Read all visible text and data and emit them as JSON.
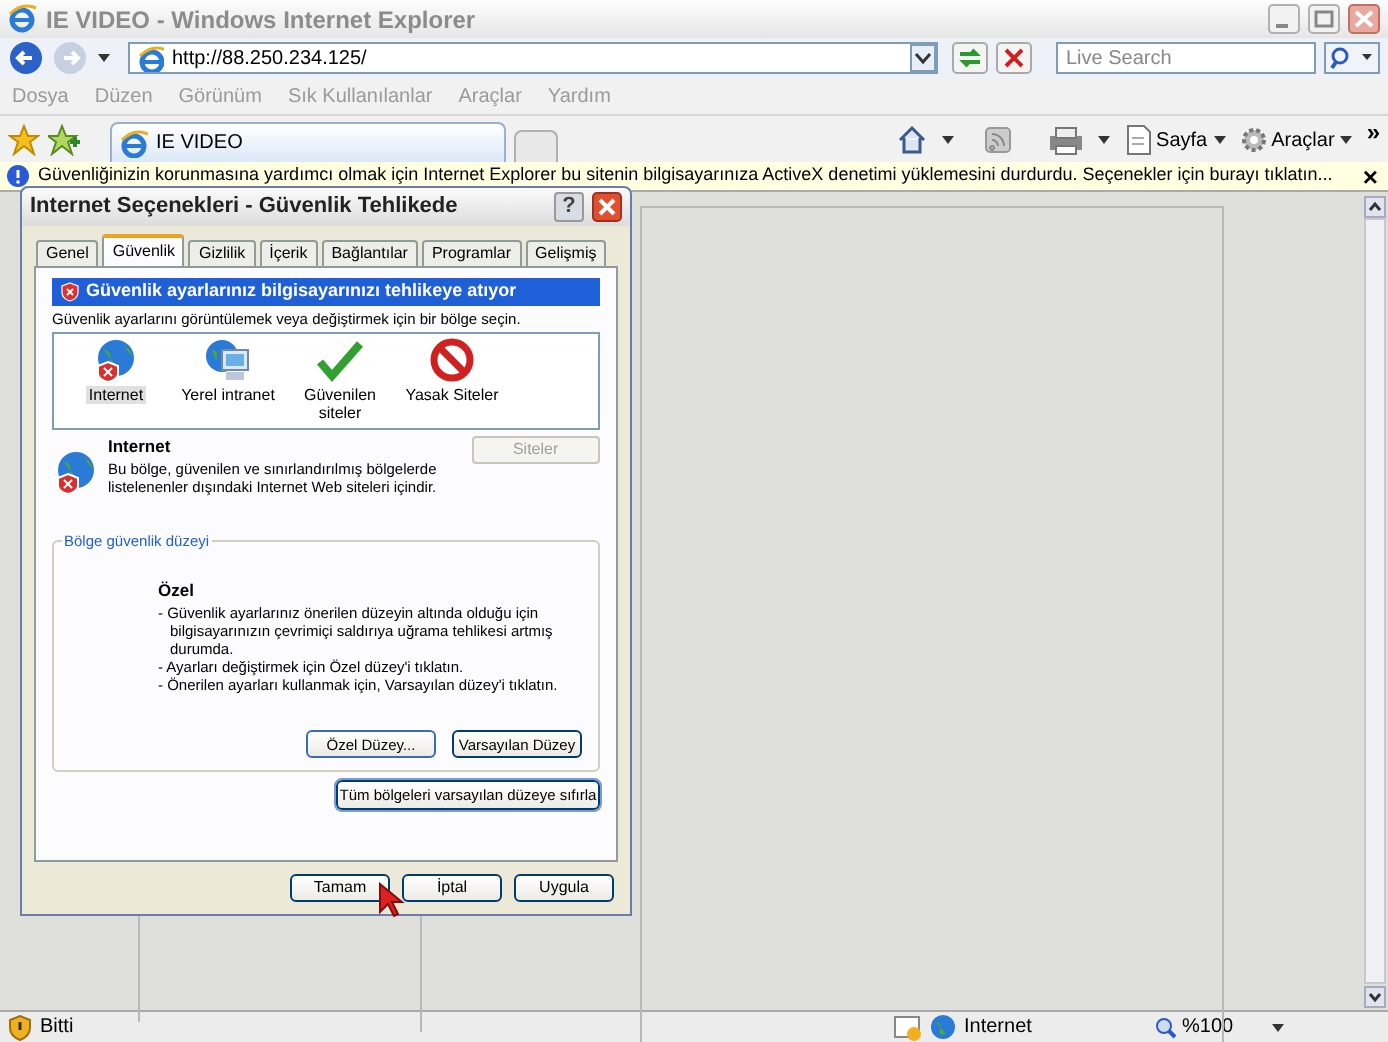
{
  "window": {
    "title": "IE VIDEO - Windows Internet Explorer"
  },
  "address": {
    "value": "http://88.250.234.125/"
  },
  "search": {
    "placeholder": "Live Search"
  },
  "menu": [
    "Dosya",
    "Düzen",
    "Görünüm",
    "Sık Kullanılanlar",
    "Araçlar",
    "Yardım"
  ],
  "tabs": [
    {
      "label": "IE VIDEO",
      "selected": true
    }
  ],
  "toolbar": {
    "page": "Sayfa",
    "tools": "Araçlar",
    "more": "»"
  },
  "info_bar": {
    "text": "Güvenliğinizin korunmasına yardımcı olmak için Internet Explorer bu sitenin bilgisayarınıza ActiveX denetimi yüklemesini durdurdu. Seçenekler için burayı tıklatın...",
    "close": "×"
  },
  "dialog": {
    "title": "Internet Seçenekleri - Güvenlik Tehlikede",
    "help": "?",
    "tabs": [
      {
        "label": "Genel",
        "selected": false
      },
      {
        "label": "Güvenlik",
        "selected": true
      },
      {
        "label": "Gizlilik",
        "selected": false
      },
      {
        "label": "İçerik",
        "selected": false
      },
      {
        "label": "Bağlantılar",
        "selected": false
      },
      {
        "label": "Programlar",
        "selected": false
      },
      {
        "label": "Gelişmiş",
        "selected": false
      }
    ],
    "warning": "Güvenlik ayarlarınız bilgisayarınızı tehlikeye atıyor",
    "instruction": "Güvenlik ayarlarını görüntülemek veya değiştirmek için bir bölge seçin.",
    "zones": [
      {
        "kind": "internet",
        "label": "Internet",
        "selected": true
      },
      {
        "kind": "intranet",
        "label": "Yerel intranet",
        "selected": false
      },
      {
        "kind": "trusted",
        "label": "Güvenilen siteler",
        "selected": false
      },
      {
        "kind": "restricted",
        "label": "Yasak Siteler",
        "selected": false
      }
    ],
    "zone_title": "Internet",
    "zone_description": "Bu bölge, güvenilen ve sınırlandırılmış bölgelerde listelenenler dışındaki Internet Web siteleri içindir.",
    "sites_button": {
      "label": "Siteler",
      "disabled": true
    },
    "group_label": "Bölge güvenlik düzeyi",
    "level_title": "Özel",
    "level_lines": [
      "- Güvenlik ayarlarınız önerilen düzeyin altında olduğu için bilgisayarınızın çevrimiçi saldırıya uğrama tehlikesi artmış durumda.",
      "- Ayarları değiştirmek için Özel düzey'i tıklatın.",
      "- Önerilen ayarları kullanmak için, Varsayılan düzey'i tıklatın."
    ],
    "level_buttons": [
      "Özel Düzey...",
      "Varsayılan Düzey"
    ],
    "reset_button": "Tüm bölgeleri varsayılan düzeye sıfırla",
    "buttons": [
      "Tamam",
      "İptal",
      "Uygula"
    ]
  },
  "status_bar": {
    "text": "Bitti",
    "zone": "Internet",
    "zoom": "%100"
  }
}
